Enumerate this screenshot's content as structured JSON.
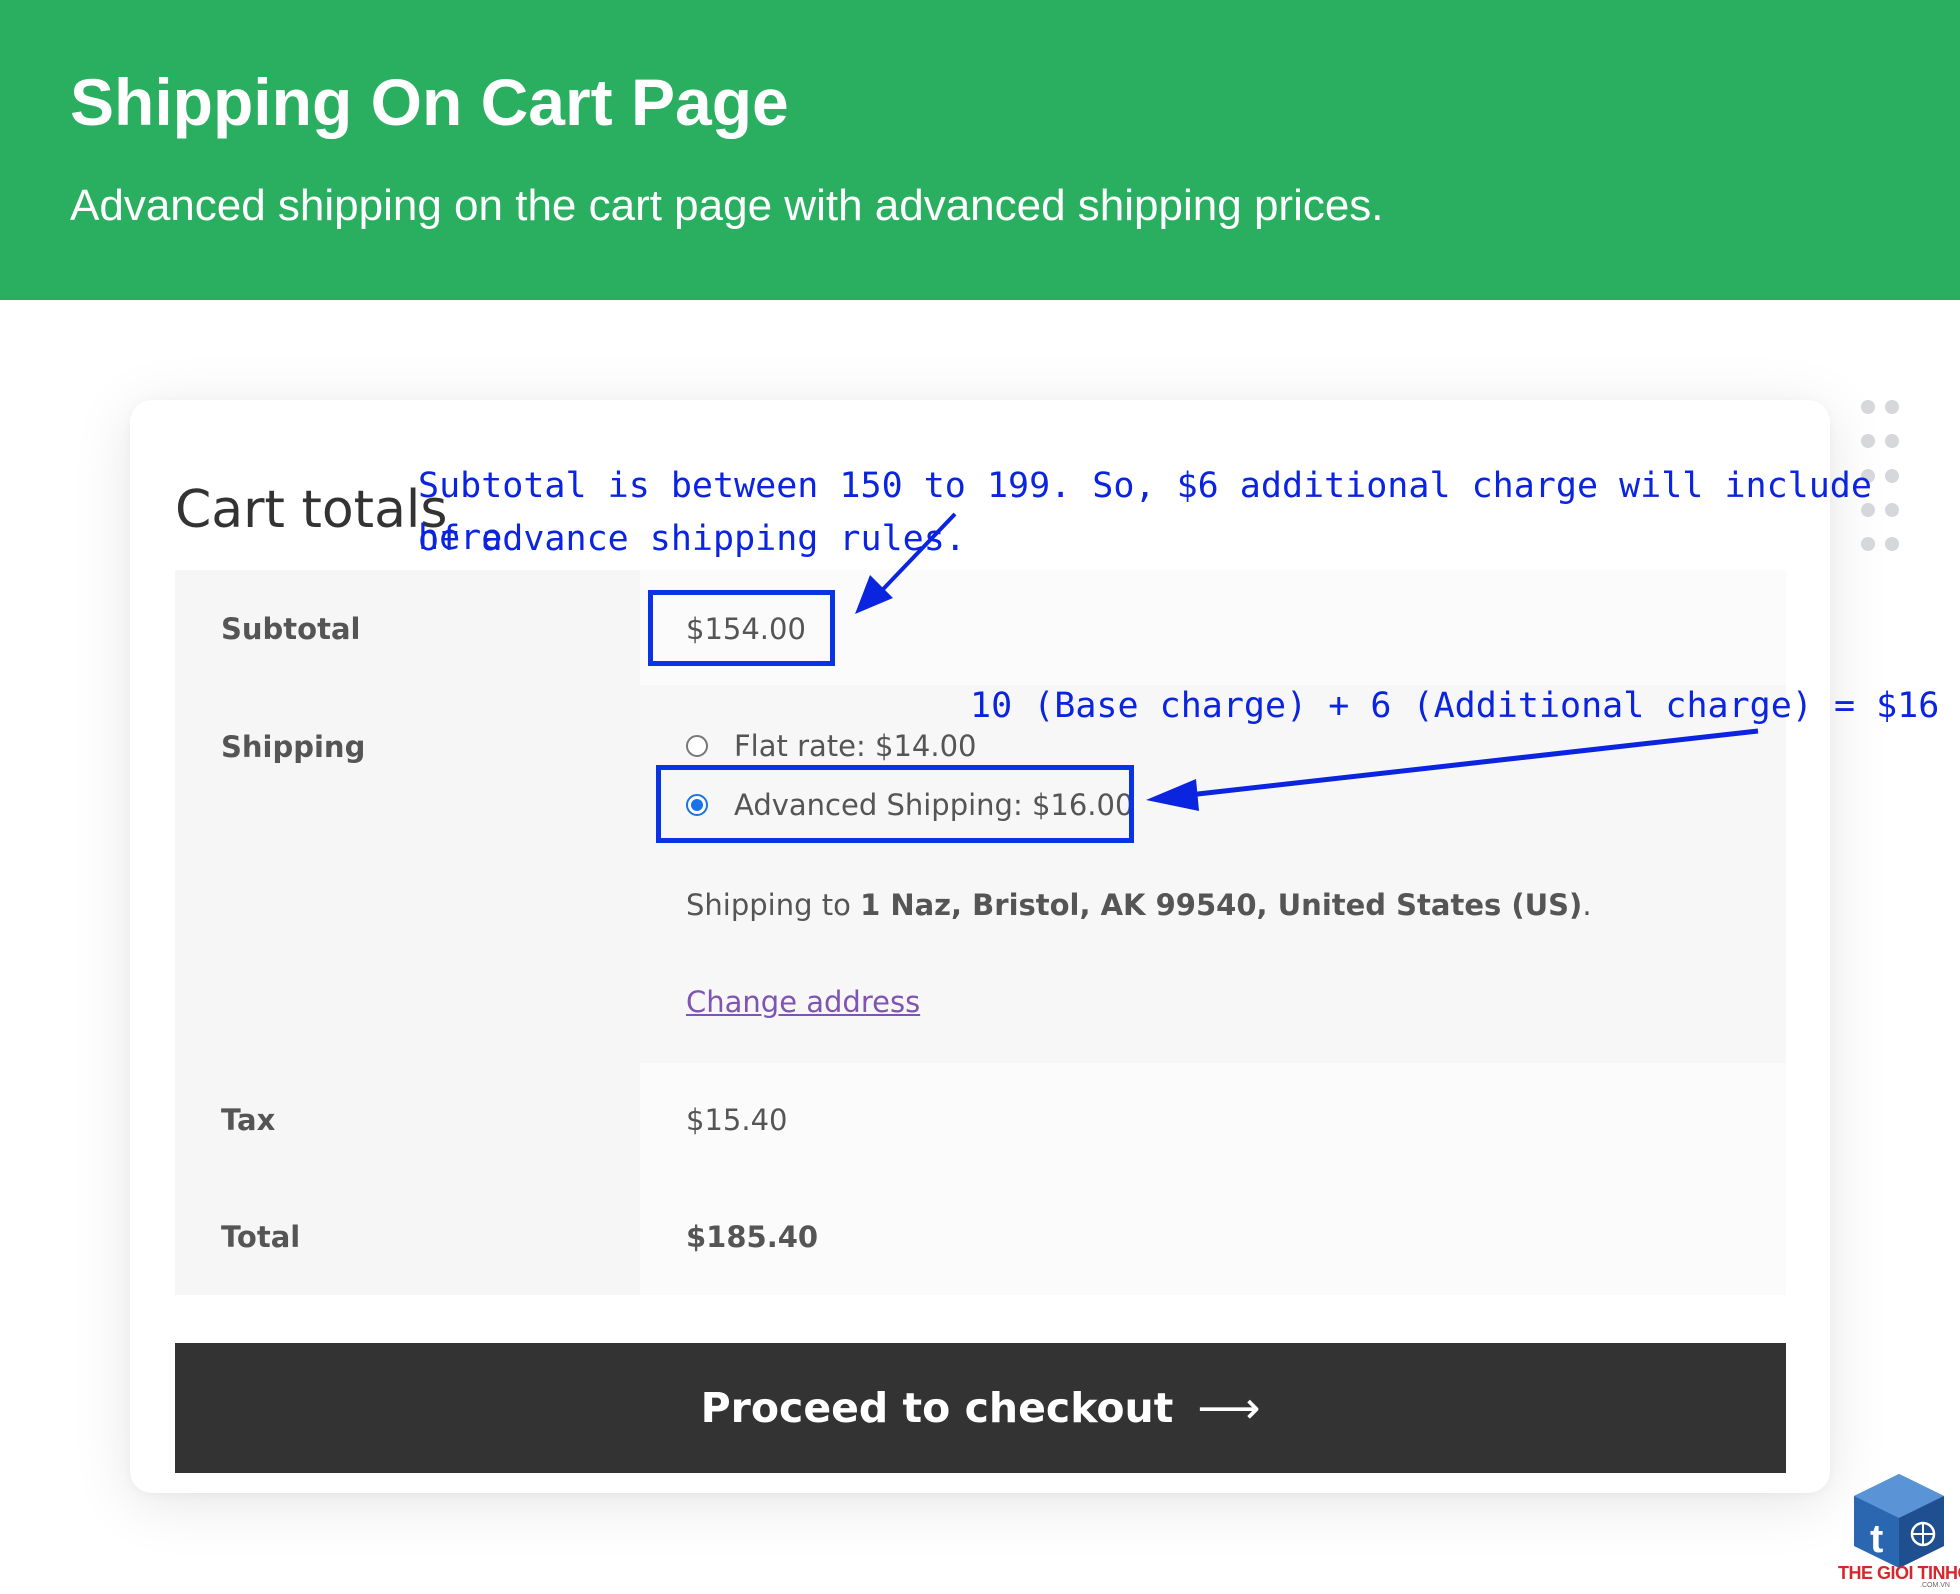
{
  "banner": {
    "title": "Shipping On Cart Page",
    "subtitle": "Advanced shipping on the cart page with advanced shipping prices.",
    "color": "#2aaf60"
  },
  "cart": {
    "heading": "Cart totals",
    "subtotal": {
      "label": "Subtotal",
      "value": "$154.00"
    },
    "shipping": {
      "label": "Shipping",
      "options": [
        {
          "label": "Flat rate: $14.00",
          "selected": false
        },
        {
          "label": "Advanced Shipping: $16.00",
          "selected": true
        }
      ],
      "destination_prefix": "Shipping to ",
      "destination_address": "1 Naz, Bristol, AK 99540, United States (US)",
      "destination_suffix": ".",
      "change_address": "Change address"
    },
    "tax": {
      "label": "Tax",
      "value": "$15.40"
    },
    "total": {
      "label": "Total",
      "value": "$185.40"
    },
    "checkout_button": {
      "label": "Proceed to checkout",
      "icon": "arrow-right-icon"
    }
  },
  "annotations": {
    "subtotal_note_line1": "Subtotal is between 150 to 199. So, $6 additional charge will include here",
    "subtotal_note_line2": "of advance shipping rules.",
    "shipping_note": "10 (Base charge) + 6 (Additional charge) = $16",
    "color": "#0a24e0"
  },
  "watermark": {
    "text": "THE GIOI TINHOC",
    "subtext": ".COM.VN",
    "icon": "cube-logo-icon"
  }
}
